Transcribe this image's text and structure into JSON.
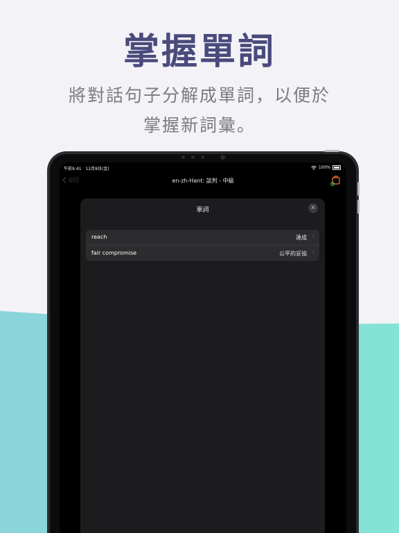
{
  "headline": "掌握單詞",
  "subheadline": {
    "line1": "將對話句子分解成單詞，以便於",
    "line2": "掌握新詞彙。"
  },
  "status_bar": {
    "time_date": "午前9:41　12月8日(金)",
    "battery_percent": "100%",
    "battery_level": 1.0
  },
  "nav": {
    "back_label": "返回",
    "title": "en-zh-Hant: 談判 - 中級",
    "icon": "lesson-icon"
  },
  "sheet": {
    "title": "單詞",
    "close_icon": "close-icon",
    "items": [
      {
        "word": "reach",
        "translation": "達成"
      },
      {
        "word": "fair compromise",
        "translation": "公平的妥協"
      }
    ]
  },
  "colors": {
    "background": "#f3f2f7",
    "headline": "#4a4a7c",
    "teal_left": "#8ad4da",
    "teal_right": "#84e3d6",
    "accent_orange": "#ff7a2f",
    "accent_green": "#30d158"
  }
}
